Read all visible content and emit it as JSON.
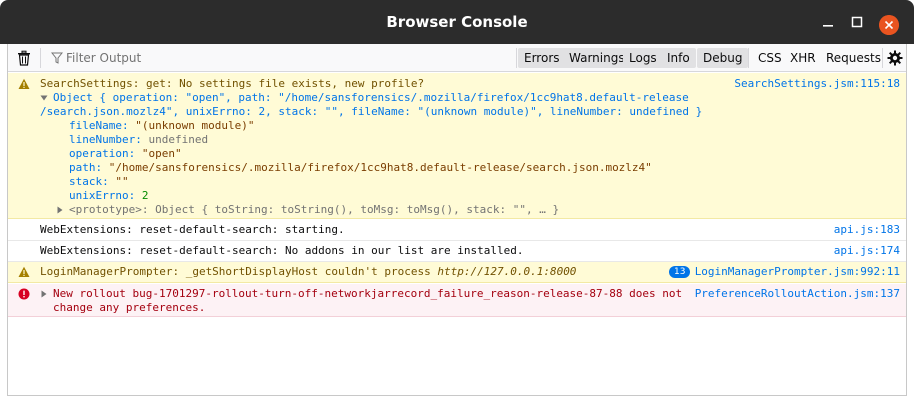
{
  "window": {
    "title": "Browser Console",
    "close_color": "#e95420"
  },
  "toolbar": {
    "clear_icon": "trash-icon",
    "filter_placeholder": "Filter Output",
    "filters": [
      "Errors",
      "Warnings",
      "Logs",
      "Info",
      "Debug"
    ],
    "toggles": [
      "CSS",
      "XHR",
      "Requests"
    ],
    "settings_icon": "gear-icon"
  },
  "messages": {
    "m1": {
      "level": "warning",
      "text": "SearchSettings: get: No settings file exists, new profile?",
      "location": "SearchSettings.jsm:115:18",
      "object_lines": [
        "Object { operation: \"open\", path: \"/home/sansforensics/.mozilla/firefox/1cc9hat8.default-release",
        "/search.json.mozlz4\", unixErrno: 2, stack: \"\", fileName: \"(unknown module)\", lineNumber: undefined }"
      ],
      "props": [
        {
          "key": "fileName:",
          "value": "\"(unknown module)\""
        },
        {
          "key": "lineNumber:",
          "value": "undefined"
        },
        {
          "key": "operation:",
          "value": "\"open\""
        },
        {
          "key": "path:",
          "value": "\"/home/sansforensics/.mozilla/firefox/1cc9hat8.default-release/search.json.mozlz4\""
        },
        {
          "key": "stack:",
          "value": "\"\""
        },
        {
          "key": "unixErrno:",
          "value": "2"
        }
      ],
      "prototype": "<prototype>: Object { toString: toString(), toMsg: toMsg(), stack: \"\", … }"
    },
    "m2": {
      "level": "log",
      "text": "WebExtensions: reset-default-search: starting.",
      "location": "api.js:183"
    },
    "m3": {
      "level": "log",
      "text": "WebExtensions: reset-default-search: No addons in our list are installed.",
      "location": "api.js:174"
    },
    "m4": {
      "level": "warning",
      "text": "LoginManagerPrompter: _getShortDisplayHost couldn't process",
      "url": "http://127.0.0.1:8000",
      "repeat_count": "13",
      "location": "LoginManagerPrompter.jsm:992:11"
    },
    "m5": {
      "level": "error",
      "line1": "New rollout bug-1701297-rollout-turn-off-networkjarrecord_failure_reason-release-87-88 does not",
      "line2": "change any preferences.",
      "location": "PreferenceRolloutAction.jsm:137"
    }
  }
}
